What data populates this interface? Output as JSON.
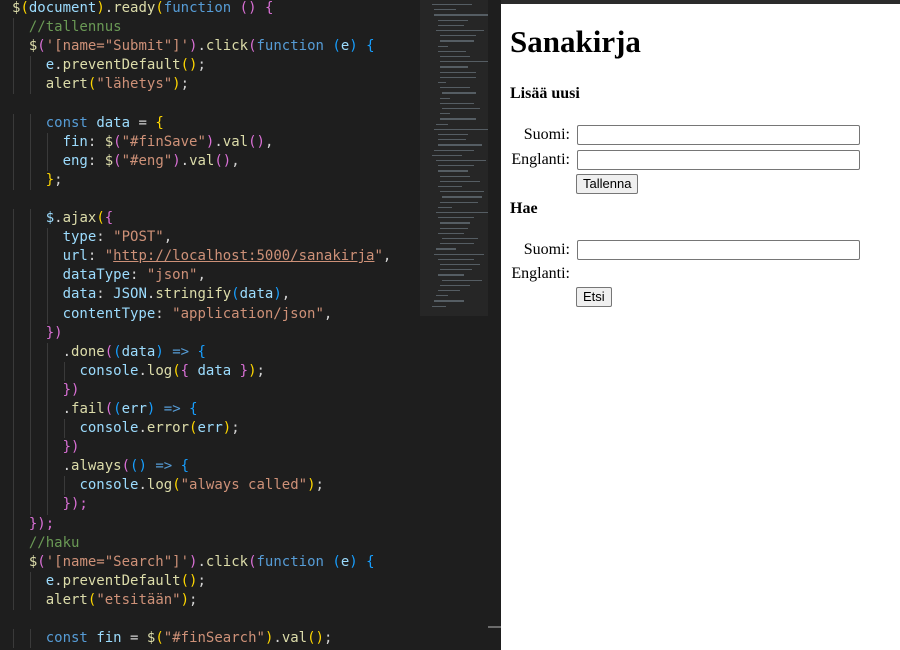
{
  "editor": {
    "lines": [
      [
        [
          "$",
          "t-fn"
        ],
        [
          "(",
          "t-b1"
        ],
        [
          "document",
          "t-var"
        ],
        [
          ")",
          "t-b1"
        ],
        [
          ".",
          "t-pun"
        ],
        [
          "ready",
          "t-fn"
        ],
        [
          "(",
          "t-b1"
        ],
        [
          "function",
          "t-kw"
        ],
        [
          " ",
          "t-pun"
        ],
        [
          "()",
          "t-b2"
        ],
        [
          " ",
          "t-pun"
        ],
        [
          "{",
          "t-b2"
        ]
      ],
      [
        [
          "  ",
          "t-pun"
        ],
        [
          "//tallennus",
          "t-cm"
        ]
      ],
      [
        [
          "  ",
          "t-pun"
        ],
        [
          "$",
          "t-fn"
        ],
        [
          "(",
          "t-b2"
        ],
        [
          "'[name=\"Submit\"]'",
          "t-str"
        ],
        [
          ")",
          "t-b2"
        ],
        [
          ".",
          "t-pun"
        ],
        [
          "click",
          "t-fn"
        ],
        [
          "(",
          "t-b2"
        ],
        [
          "function",
          "t-kw"
        ],
        [
          " ",
          "t-pun"
        ],
        [
          "(",
          "t-b3"
        ],
        [
          "e",
          "t-var"
        ],
        [
          ")",
          "t-b3"
        ],
        [
          " ",
          "t-pun"
        ],
        [
          "{",
          "t-b3"
        ]
      ],
      [
        [
          "    ",
          "t-pun"
        ],
        [
          "e",
          "t-var"
        ],
        [
          ".",
          "t-pun"
        ],
        [
          "preventDefault",
          "t-fn"
        ],
        [
          "()",
          "t-b1"
        ],
        [
          ";",
          "t-pun"
        ]
      ],
      [
        [
          "    ",
          "t-pun"
        ],
        [
          "alert",
          "t-fn"
        ],
        [
          "(",
          "t-b1"
        ],
        [
          "\"lähetys\"",
          "t-str"
        ],
        [
          ")",
          "t-b1"
        ],
        [
          ";",
          "t-pun"
        ]
      ],
      [
        [
          "",
          "t-pun"
        ]
      ],
      [
        [
          "    ",
          "t-pun"
        ],
        [
          "const",
          "t-kw"
        ],
        [
          " ",
          "t-pun"
        ],
        [
          "data",
          "t-var"
        ],
        [
          " = ",
          "t-pun"
        ],
        [
          "{",
          "t-b1"
        ]
      ],
      [
        [
          "      ",
          "t-pun"
        ],
        [
          "fin",
          "t-var"
        ],
        [
          ": ",
          "t-pun"
        ],
        [
          "$",
          "t-fn"
        ],
        [
          "(",
          "t-b2"
        ],
        [
          "\"#finSave\"",
          "t-str"
        ],
        [
          ")",
          "t-b2"
        ],
        [
          ".",
          "t-pun"
        ],
        [
          "val",
          "t-fn"
        ],
        [
          "()",
          "t-b2"
        ],
        [
          ",",
          "t-pun"
        ]
      ],
      [
        [
          "      ",
          "t-pun"
        ],
        [
          "eng",
          "t-var"
        ],
        [
          ": ",
          "t-pun"
        ],
        [
          "$",
          "t-fn"
        ],
        [
          "(",
          "t-b2"
        ],
        [
          "\"#eng\"",
          "t-str"
        ],
        [
          ")",
          "t-b2"
        ],
        [
          ".",
          "t-pun"
        ],
        [
          "val",
          "t-fn"
        ],
        [
          "()",
          "t-b2"
        ],
        [
          ",",
          "t-pun"
        ]
      ],
      [
        [
          "    ",
          "t-pun"
        ],
        [
          "}",
          "t-b1"
        ],
        [
          ";",
          "t-pun"
        ]
      ],
      [
        [
          "",
          "t-pun"
        ]
      ],
      [
        [
          "    ",
          "t-pun"
        ],
        [
          "$",
          "t-var"
        ],
        [
          ".",
          "t-pun"
        ],
        [
          "ajax",
          "t-fn"
        ],
        [
          "(",
          "t-b1"
        ],
        [
          "{",
          "t-b2"
        ]
      ],
      [
        [
          "      ",
          "t-pun"
        ],
        [
          "type",
          "t-var"
        ],
        [
          ": ",
          "t-pun"
        ],
        [
          "\"POST\"",
          "t-str"
        ],
        [
          ",",
          "t-pun"
        ]
      ],
      [
        [
          "      ",
          "t-pun"
        ],
        [
          "url",
          "t-var"
        ],
        [
          ": ",
          "t-pun"
        ],
        [
          "\"",
          "t-str"
        ],
        [
          "http://localhost:5000/sanakirja",
          "t-url"
        ],
        [
          "\"",
          "t-str"
        ],
        [
          ",",
          "t-pun"
        ]
      ],
      [
        [
          "      ",
          "t-pun"
        ],
        [
          "dataType",
          "t-var"
        ],
        [
          ": ",
          "t-pun"
        ],
        [
          "\"json\"",
          "t-str"
        ],
        [
          ",",
          "t-pun"
        ]
      ],
      [
        [
          "      ",
          "t-pun"
        ],
        [
          "data",
          "t-var"
        ],
        [
          ": ",
          "t-pun"
        ],
        [
          "JSON",
          "t-var"
        ],
        [
          ".",
          "t-pun"
        ],
        [
          "stringify",
          "t-fn"
        ],
        [
          "(",
          "t-b3"
        ],
        [
          "data",
          "t-var"
        ],
        [
          ")",
          "t-b3"
        ],
        [
          ",",
          "t-pun"
        ]
      ],
      [
        [
          "      ",
          "t-pun"
        ],
        [
          "contentType",
          "t-var"
        ],
        [
          ": ",
          "t-pun"
        ],
        [
          "\"application/json\"",
          "t-str"
        ],
        [
          ",",
          "t-pun"
        ]
      ],
      [
        [
          "    ",
          "t-pun"
        ],
        [
          "})",
          "t-b2"
        ]
      ],
      [
        [
          "      ",
          "t-pun"
        ],
        [
          ".",
          "t-pun"
        ],
        [
          "done",
          "t-fn"
        ],
        [
          "(",
          "t-b2"
        ],
        [
          "(",
          "t-b3"
        ],
        [
          "data",
          "t-var"
        ],
        [
          ")",
          "t-b3"
        ],
        [
          " ",
          "t-pun"
        ],
        [
          "=>",
          "t-kw"
        ],
        [
          " ",
          "t-pun"
        ],
        [
          "{",
          "t-b3"
        ]
      ],
      [
        [
          "        ",
          "t-pun"
        ],
        [
          "console",
          "t-var"
        ],
        [
          ".",
          "t-pun"
        ],
        [
          "log",
          "t-fn"
        ],
        [
          "(",
          "t-b1"
        ],
        [
          "{",
          "t-b2"
        ],
        [
          " data ",
          "t-var"
        ],
        [
          "}",
          "t-b2"
        ],
        [
          ")",
          "t-b1"
        ],
        [
          ";",
          "t-pun"
        ]
      ],
      [
        [
          "      ",
          "t-pun"
        ],
        [
          "})",
          "t-b2"
        ]
      ],
      [
        [
          "      ",
          "t-pun"
        ],
        [
          ".",
          "t-pun"
        ],
        [
          "fail",
          "t-fn"
        ],
        [
          "(",
          "t-b2"
        ],
        [
          "(",
          "t-b3"
        ],
        [
          "err",
          "t-var"
        ],
        [
          ")",
          "t-b3"
        ],
        [
          " ",
          "t-pun"
        ],
        [
          "=>",
          "t-kw"
        ],
        [
          " ",
          "t-pun"
        ],
        [
          "{",
          "t-b3"
        ]
      ],
      [
        [
          "        ",
          "t-pun"
        ],
        [
          "console",
          "t-var"
        ],
        [
          ".",
          "t-pun"
        ],
        [
          "error",
          "t-fn"
        ],
        [
          "(",
          "t-b1"
        ],
        [
          "err",
          "t-var"
        ],
        [
          ")",
          "t-b1"
        ],
        [
          ";",
          "t-pun"
        ]
      ],
      [
        [
          "      ",
          "t-pun"
        ],
        [
          "})",
          "t-b2"
        ]
      ],
      [
        [
          "      ",
          "t-pun"
        ],
        [
          ".",
          "t-pun"
        ],
        [
          "always",
          "t-fn"
        ],
        [
          "(",
          "t-b2"
        ],
        [
          "()",
          "t-b3"
        ],
        [
          " ",
          "t-pun"
        ],
        [
          "=>",
          "t-kw"
        ],
        [
          " ",
          "t-pun"
        ],
        [
          "{",
          "t-b3"
        ]
      ],
      [
        [
          "        ",
          "t-pun"
        ],
        [
          "console",
          "t-var"
        ],
        [
          ".",
          "t-pun"
        ],
        [
          "log",
          "t-fn"
        ],
        [
          "(",
          "t-b1"
        ],
        [
          "\"always called\"",
          "t-str"
        ],
        [
          ")",
          "t-b1"
        ],
        [
          ";",
          "t-pun"
        ]
      ],
      [
        [
          "      ",
          "t-pun"
        ],
        [
          "});",
          "t-b2"
        ]
      ],
      [
        [
          "  ",
          "t-pun"
        ],
        [
          "});",
          "t-b2"
        ]
      ],
      [
        [
          "  ",
          "t-pun"
        ],
        [
          "//haku",
          "t-cm"
        ]
      ],
      [
        [
          "  ",
          "t-pun"
        ],
        [
          "$",
          "t-fn"
        ],
        [
          "(",
          "t-b2"
        ],
        [
          "'[name=\"Search\"]'",
          "t-str"
        ],
        [
          ")",
          "t-b2"
        ],
        [
          ".",
          "t-pun"
        ],
        [
          "click",
          "t-fn"
        ],
        [
          "(",
          "t-b2"
        ],
        [
          "function",
          "t-kw"
        ],
        [
          " ",
          "t-pun"
        ],
        [
          "(",
          "t-b3"
        ],
        [
          "e",
          "t-var"
        ],
        [
          ")",
          "t-b3"
        ],
        [
          " ",
          "t-pun"
        ],
        [
          "{",
          "t-b3"
        ]
      ],
      [
        [
          "    ",
          "t-pun"
        ],
        [
          "e",
          "t-var"
        ],
        [
          ".",
          "t-pun"
        ],
        [
          "preventDefault",
          "t-fn"
        ],
        [
          "()",
          "t-b1"
        ],
        [
          ";",
          "t-pun"
        ]
      ],
      [
        [
          "    ",
          "t-pun"
        ],
        [
          "alert",
          "t-fn"
        ],
        [
          "(",
          "t-b1"
        ],
        [
          "\"etsitään\"",
          "t-str"
        ],
        [
          ")",
          "t-b1"
        ],
        [
          ";",
          "t-pun"
        ]
      ],
      [
        [
          "",
          "t-pun"
        ]
      ],
      [
        [
          "    ",
          "t-pun"
        ],
        [
          "const",
          "t-kw"
        ],
        [
          " ",
          "t-pun"
        ],
        [
          "fin",
          "t-var"
        ],
        [
          " = ",
          "t-pun"
        ],
        [
          "$",
          "t-fn"
        ],
        [
          "(",
          "t-b1"
        ],
        [
          "\"#finSearch\"",
          "t-str"
        ],
        [
          ")",
          "t-b1"
        ],
        [
          ".",
          "t-pun"
        ],
        [
          "val",
          "t-fn"
        ],
        [
          "()",
          "t-b1"
        ],
        [
          ";",
          "t-pun"
        ]
      ]
    ]
  },
  "colors": {
    "editor_bg": "#1e1e1e",
    "keyword": "#569cd6",
    "function": "#dcdcaa",
    "string": "#ce9178",
    "comment": "#6a9955",
    "variable": "#9cdcfe"
  },
  "preview": {
    "title": "Sanakirja",
    "add_heading": "Lisää uusi",
    "add_form": {
      "finnish_label": "Suomi:",
      "english_label": "Englanti:",
      "finnish_value": "",
      "english_value": "",
      "save_button": "Tallenna"
    },
    "search_heading": "Hae",
    "search_form": {
      "finnish_label": "Suomi:",
      "english_label": "Englanti:",
      "finnish_value": "",
      "search_button": "Etsi"
    }
  }
}
